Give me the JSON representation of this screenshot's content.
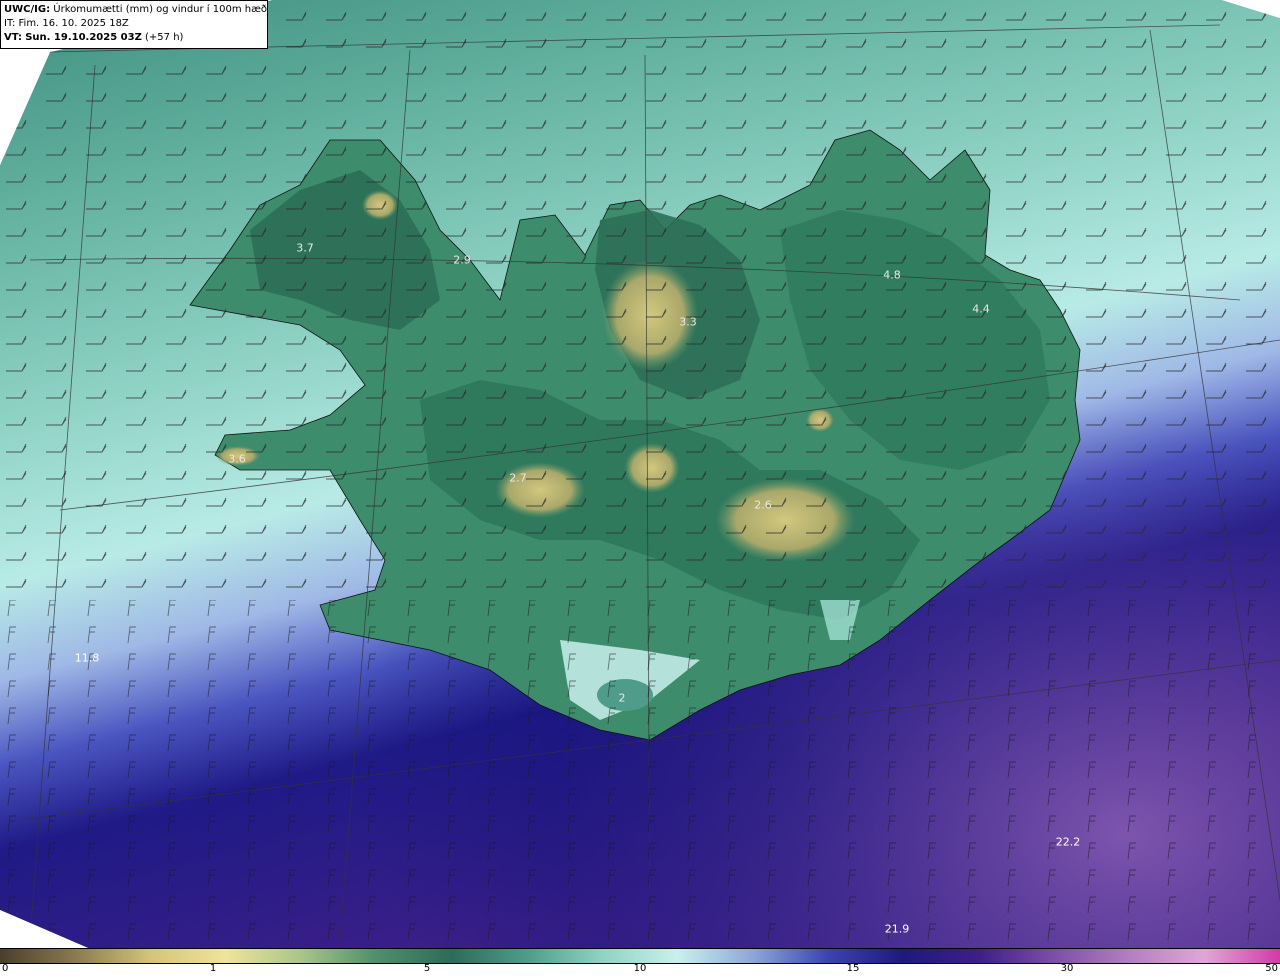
{
  "header": {
    "model": "UWC/IG:",
    "title": "Úrkomumætti (mm) og vindur í 100m hæð",
    "it_prefix": "IT:",
    "it_value": "Fim. 16. 10. 2025 18Z",
    "vt_prefix": "VT:",
    "vt_value": "Sun. 19.10.2025 03Z",
    "vt_lead": "(+57 h)"
  },
  "point_values": [
    {
      "id": "westfjords",
      "text": "3.7"
    },
    {
      "id": "westfjords-2",
      "text": "2.9"
    },
    {
      "id": "snaefellsnes",
      "text": "3.6"
    },
    {
      "id": "langjokull",
      "text": "2.7"
    },
    {
      "id": "north-central",
      "text": "3.3"
    },
    {
      "id": "northeast",
      "text": "4.8"
    },
    {
      "id": "east",
      "text": "4.4"
    },
    {
      "id": "vatnajokull",
      "text": "2.6"
    },
    {
      "id": "myrdalsjokull",
      "text": "2"
    },
    {
      "id": "sw-ocean",
      "text": "11.8"
    },
    {
      "id": "se-ocean",
      "text": "22.2"
    },
    {
      "id": "s-ocean",
      "text": "21.9"
    }
  ],
  "colorbar": {
    "ticks": [
      "0",
      "1",
      "5",
      "10",
      "15",
      "30",
      "50"
    ],
    "colors": [
      "#4a3f2c",
      "#8a7a50",
      "#d4c47a",
      "#efe49a",
      "#a9c58a",
      "#4f8f6a",
      "#2d6b5b",
      "#4f9c8a",
      "#8fd3c5",
      "#c9f0ec",
      "#8ea6d8",
      "#3b43b0",
      "#1e1a7a",
      "#3e1f86",
      "#7a4fa8",
      "#b27fc0",
      "#e0a6d6",
      "#d23aa8"
    ]
  },
  "map_colors": {
    "ocean_north": "#4f9c8a",
    "ocean_mid": "#8fd3c5",
    "ocean_pale": "#c6eeea",
    "ocean_blue": "#7d95d8",
    "ocean_deep": "#1f1a86",
    "ocean_purple": "#4a2f92",
    "land_green": "#2f7a5e",
    "land_dry": "#b9b070"
  }
}
